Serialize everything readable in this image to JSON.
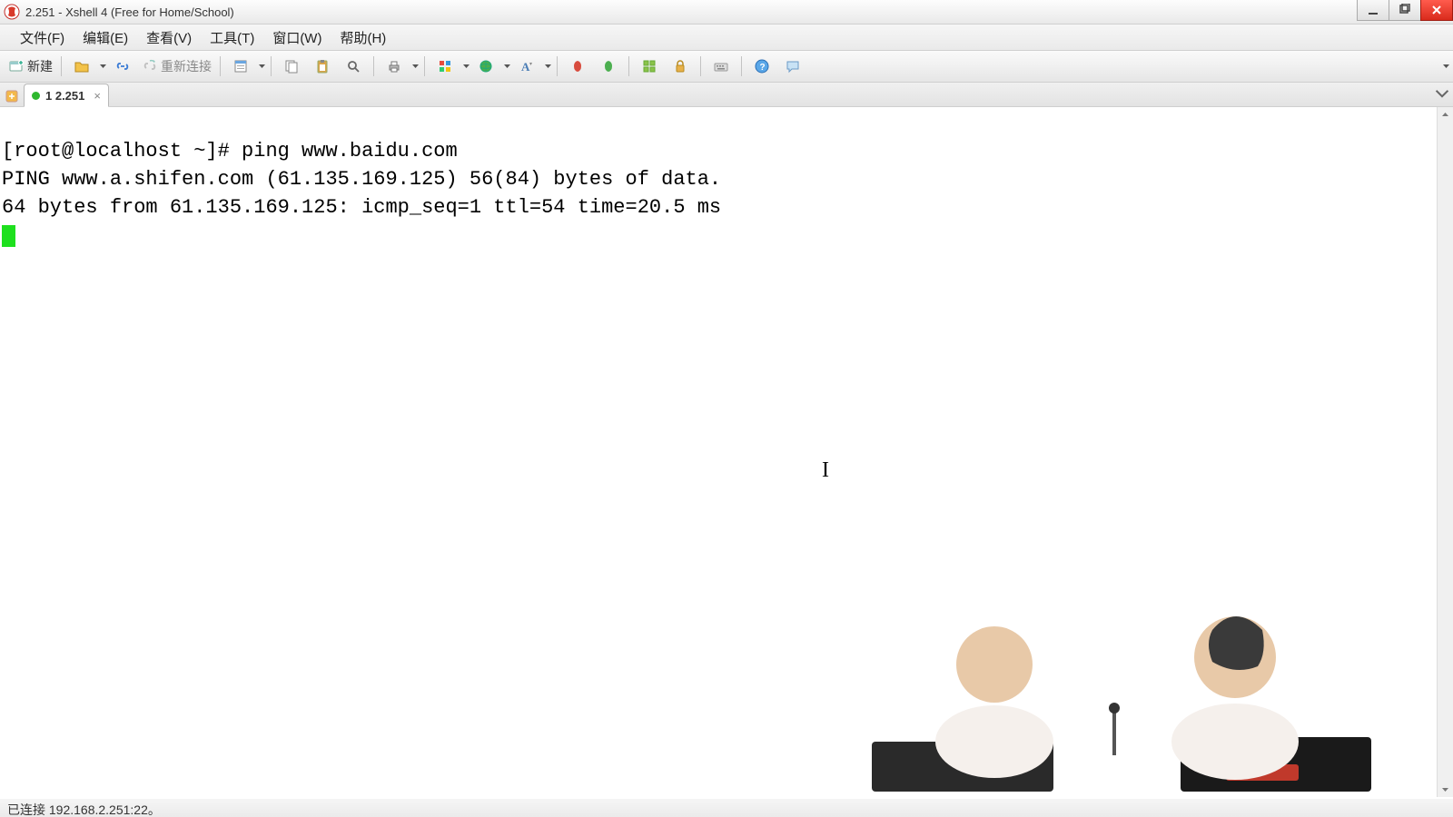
{
  "window": {
    "title": "2.251 - Xshell 4 (Free for Home/School)"
  },
  "menu": {
    "file": "文件(F)",
    "edit": "编辑(E)",
    "view": "查看(V)",
    "tools": "工具(T)",
    "window": "窗口(W)",
    "help": "帮助(H)"
  },
  "toolbar": {
    "new_label": "新建",
    "reconnect_label": "重新连接"
  },
  "tabs": {
    "tab1_label": "1 2.251"
  },
  "terminal": {
    "line1": "[root@localhost ~]# ping www.baidu.com",
    "line2": "PING www.a.shifen.com (61.135.169.125) 56(84) bytes of data.",
    "line3": "64 bytes from 61.135.169.125: icmp_seq=1 ttl=54 time=20.5 ms"
  },
  "status": {
    "text": "已连接 192.168.2.251:22。"
  }
}
